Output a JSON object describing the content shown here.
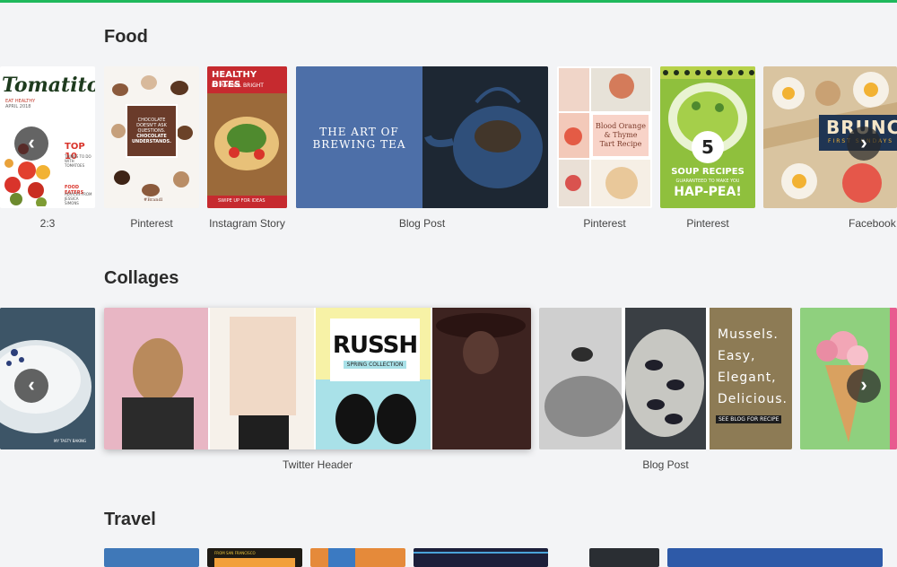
{
  "colors": {
    "accent": "#1fb85c"
  },
  "food": {
    "title": "Food",
    "cards": [
      {
        "label": "2:3",
        "headline": "Tomatito",
        "kicker": "EAT HEALTHY",
        "date": "APRIL 2018",
        "teaser": "TOP 10",
        "teaser_sub": "THINGS TO DO WITH TOMATOES",
        "section": "FOOD EATERS",
        "section_sub": "ADVICES FROM JESSICA SIMONS"
      },
      {
        "label": "Pinterest",
        "badge_lines": [
          "CHOCOLATE",
          "DOESN'T ASK",
          "QUESTIONS.",
          "CHOCOLATE",
          "UNDERSTANDS."
        ],
        "brand": "#Brandl"
      },
      {
        "label": "Instagram Story",
        "title": "HEALTHY BITES",
        "byline": "BY RACHEL BRIGHT",
        "cta": "SWIPE UP FOR IDEAS"
      },
      {
        "label": "Blog Post",
        "title_line1": "THE ART OF",
        "title_line2": "BREWING TEA"
      },
      {
        "label": "Pinterest",
        "title": "Blood Orange & Thyme Tart Recipe"
      },
      {
        "label": "Pinterest",
        "number": "5",
        "line1": "SOUP RECIPES",
        "line2": "GUARANTEED TO MAKE YOU",
        "line3": "HAP-PEA!"
      },
      {
        "label": "Facebook I",
        "title": "BRUNC",
        "subtitle": "FIRST SUNDAYS"
      }
    ]
  },
  "collages": {
    "title": "Collages",
    "cards": [
      {
        "label": "",
        "brand": "MY TASTY BAKING"
      },
      {
        "label": "Twitter Header",
        "brand": "RUSSH",
        "tagline": "SPRING COLLECTION"
      },
      {
        "label": "Blog Post",
        "lines": [
          "Mussels.",
          "Easy,",
          "Elegant,",
          "Delicious."
        ],
        "cta": "SEE BLOG FOR RECIPE"
      },
      {
        "label": ""
      }
    ]
  },
  "travel": {
    "title": "Travel",
    "cards": [
      {
        "label": ""
      },
      {
        "label": "",
        "text": "FROM SAN FRANCISCO"
      },
      {
        "label": ""
      },
      {
        "label": ""
      },
      {
        "label": ""
      },
      {
        "label": ""
      }
    ]
  },
  "nav": {
    "prev_symbol": "‹",
    "next_symbol": "›"
  }
}
